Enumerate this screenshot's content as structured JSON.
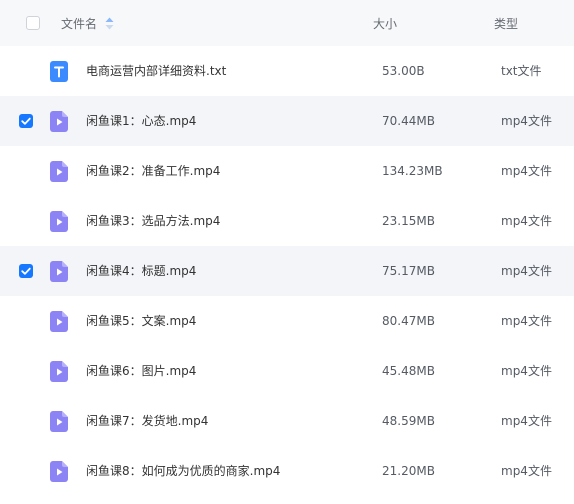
{
  "header": {
    "name_label": "文件名",
    "size_label": "大小",
    "type_label": "类型"
  },
  "colors": {
    "header_bg": "#f7f8fa",
    "selected_row_bg": "#f3f5f8",
    "checkbox_checked": "#1677ff",
    "video_icon": "#8c83f5",
    "text_icon": "#3b8bff"
  },
  "files": [
    {
      "name": "电商运营内部详细资料.txt",
      "size": "53.00B",
      "type": "txt文件",
      "icon": "text-file-icon",
      "selected": false
    },
    {
      "name": "闲鱼课1：心态.mp4",
      "size": "70.44MB",
      "type": "mp4文件",
      "icon": "video-file-icon",
      "selected": true
    },
    {
      "name": "闲鱼课2：准备工作.mp4",
      "size": "134.23MB",
      "type": "mp4文件",
      "icon": "video-file-icon",
      "selected": false
    },
    {
      "name": "闲鱼课3：选品方法.mp4",
      "size": "23.15MB",
      "type": "mp4文件",
      "icon": "video-file-icon",
      "selected": false
    },
    {
      "name": "闲鱼课4：标题.mp4",
      "size": "75.17MB",
      "type": "mp4文件",
      "icon": "video-file-icon",
      "selected": true
    },
    {
      "name": "闲鱼课5：文案.mp4",
      "size": "80.47MB",
      "type": "mp4文件",
      "icon": "video-file-icon",
      "selected": false
    },
    {
      "name": "闲鱼课6：图片.mp4",
      "size": "45.48MB",
      "type": "mp4文件",
      "icon": "video-file-icon",
      "selected": false
    },
    {
      "name": "闲鱼课7：发货地.mp4",
      "size": "48.59MB",
      "type": "mp4文件",
      "icon": "video-file-icon",
      "selected": false
    },
    {
      "name": "闲鱼课8：如何成为优质的商家.mp4",
      "size": "21.20MB",
      "type": "mp4文件",
      "icon": "video-file-icon",
      "selected": false
    }
  ]
}
